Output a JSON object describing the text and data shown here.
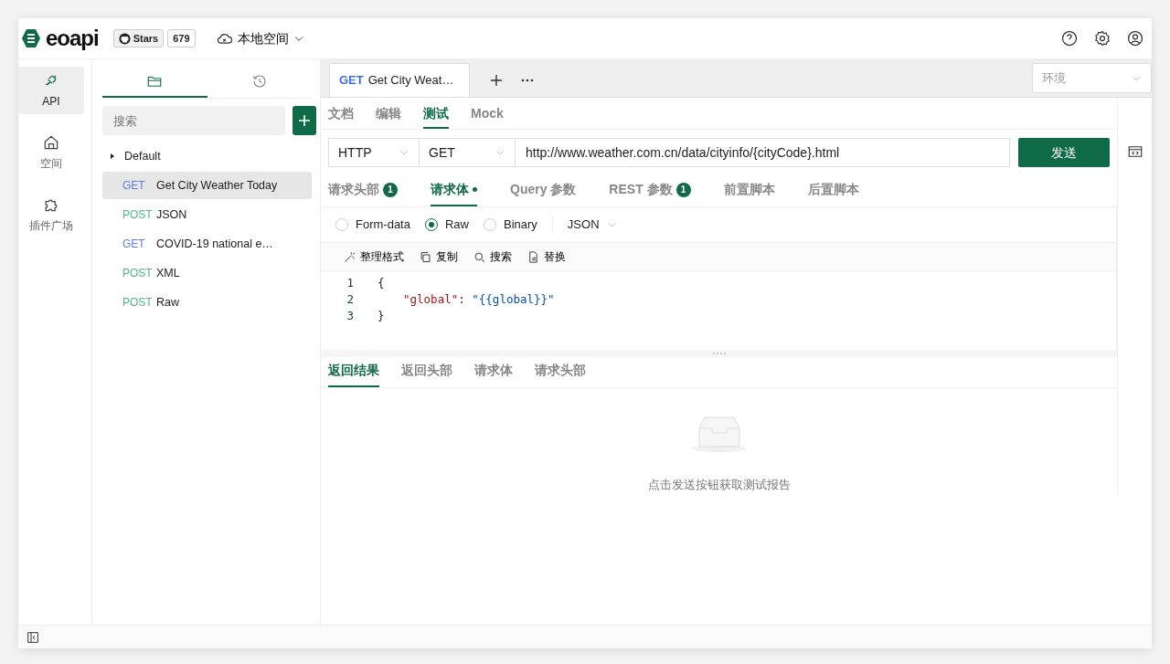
{
  "header": {
    "logo": "eoapi",
    "stars_label": "Stars",
    "stars_count": "679",
    "workspace": "本地空间"
  },
  "rail": [
    {
      "label": "API",
      "selected": true
    },
    {
      "label": "空间",
      "selected": false
    },
    {
      "label": "插件广场",
      "selected": false
    }
  ],
  "side_tabs": [
    {
      "selected": true
    },
    {
      "selected": false
    }
  ],
  "search": {
    "placeholder": "搜索"
  },
  "tree": {
    "group": "Default",
    "items": [
      {
        "method": "GET",
        "name": "Get City Weather Today",
        "selected": true
      },
      {
        "method": "POST",
        "name": "JSON",
        "selected": false
      },
      {
        "method": "GET",
        "name": "COVID-19 national e…",
        "selected": false
      },
      {
        "method": "POST",
        "name": "XML",
        "selected": false
      },
      {
        "method": "POST",
        "name": "Raw",
        "selected": false
      }
    ]
  },
  "open_tabs": [
    {
      "method": "GET",
      "title": "Get City Weat…"
    }
  ],
  "environment": {
    "placeholder": "环境"
  },
  "mode_tabs": [
    {
      "label": "文档",
      "selected": false
    },
    {
      "label": "编辑",
      "selected": false
    },
    {
      "label": "测试",
      "selected": true
    },
    {
      "label": "Mock",
      "selected": false
    }
  ],
  "request": {
    "protocol": "HTTP",
    "method": "GET",
    "url": "http://www.weather.com.cn/data/cityinfo/{cityCode}.html",
    "send": "发送"
  },
  "request_tabs": [
    {
      "label": "请求头部",
      "badge": "1",
      "dot": false,
      "selected": false
    },
    {
      "label": "请求体",
      "dot": true,
      "selected": true
    },
    {
      "label": "Query 参数",
      "dot": false,
      "selected": false
    },
    {
      "label": "REST 参数",
      "badge": "1",
      "dot": false,
      "selected": false
    },
    {
      "label": "前置脚本",
      "dot": false,
      "selected": false
    },
    {
      "label": "后置脚本",
      "dot": false,
      "selected": false
    }
  ],
  "body_types": [
    {
      "label": "Form-data",
      "selected": false
    },
    {
      "label": "Raw",
      "selected": true
    },
    {
      "label": "Binary",
      "selected": false
    }
  ],
  "format": "JSON",
  "editor_tools": [
    {
      "label": "整理格式"
    },
    {
      "label": "复制"
    },
    {
      "label": "搜索"
    },
    {
      "label": "替换"
    }
  ],
  "code_lines": [
    {
      "number": "1",
      "tokens": [
        {
          "kind": "punct",
          "text": "{"
        }
      ]
    },
    {
      "number": "2",
      "tokens": [
        {
          "kind": "key",
          "text": "\"global\""
        },
        {
          "kind": "punct",
          "text": ": "
        },
        {
          "kind": "string",
          "text": "\"{{global}}\""
        }
      ]
    },
    {
      "number": "3",
      "tokens": [
        {
          "kind": "punct",
          "text": "}"
        }
      ]
    }
  ],
  "response_tabs": [
    {
      "label": "返回结果",
      "selected": true
    },
    {
      "label": "返回头部",
      "selected": false
    },
    {
      "label": "请求体",
      "selected": false
    },
    {
      "label": "请求头部",
      "selected": false
    }
  ],
  "empty_message": "点击发送按钮获取测试报告"
}
